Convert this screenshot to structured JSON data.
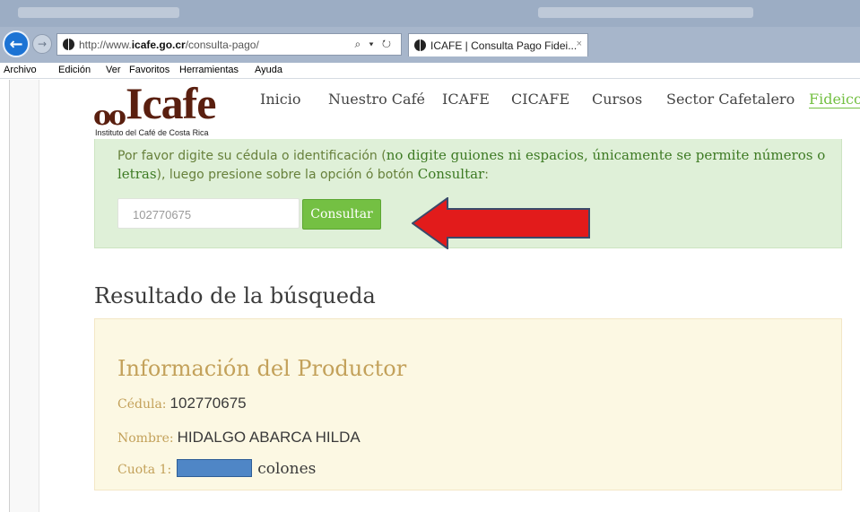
{
  "browser": {
    "url_prefix": "http://www.",
    "url_domain": "icafe.go.cr",
    "url_path": "/consulta-pago/",
    "url_controls": "⌕ ▾ ↻",
    "tab_title": "ICAFE | Consulta Pago Fidei...",
    "tab_close": "×",
    "back_glyph": "←",
    "forward_glyph": "→",
    "menu": [
      "Archivo",
      "Edición",
      "Ver",
      "Favoritos",
      "Herramientas",
      "Ayuda"
    ]
  },
  "logo": {
    "dots": "oo",
    "word": "Icafe",
    "subtitle": "Instituto del Café de Costa Rica"
  },
  "nav": [
    "Inicio",
    "Nuestro Café",
    "ICAFE",
    "CICAFE",
    "Cursos",
    "Sector Cafetalero",
    "Fideico"
  ],
  "search": {
    "instr_1": "Por favor digite su cédula o identificación (",
    "instr_hl_1": "no digite guiones ni espacios, únicamente se permite números o letras",
    "instr_2": "), luego presione sobre la opción ó botón ",
    "instr_hl_2": "Consultar",
    "instr_3": ":",
    "input_value": "102770675",
    "button_label": "Consultar"
  },
  "result": {
    "heading": "Resultado de la búsqueda",
    "info_title": "Información del Productor",
    "cedula_label": "Cédula:",
    "cedula_value": "102770675",
    "nombre_label": "Nombre:",
    "nombre_value": "HIDALGO ABARCA HILDA",
    "cuota_label": "Cuota 1:",
    "cuota_suffix": "colones"
  },
  "colors": {
    "accent_green": "#74c043",
    "arrow_red": "#e21b1b",
    "redaction_blue": "#4f86c6"
  }
}
